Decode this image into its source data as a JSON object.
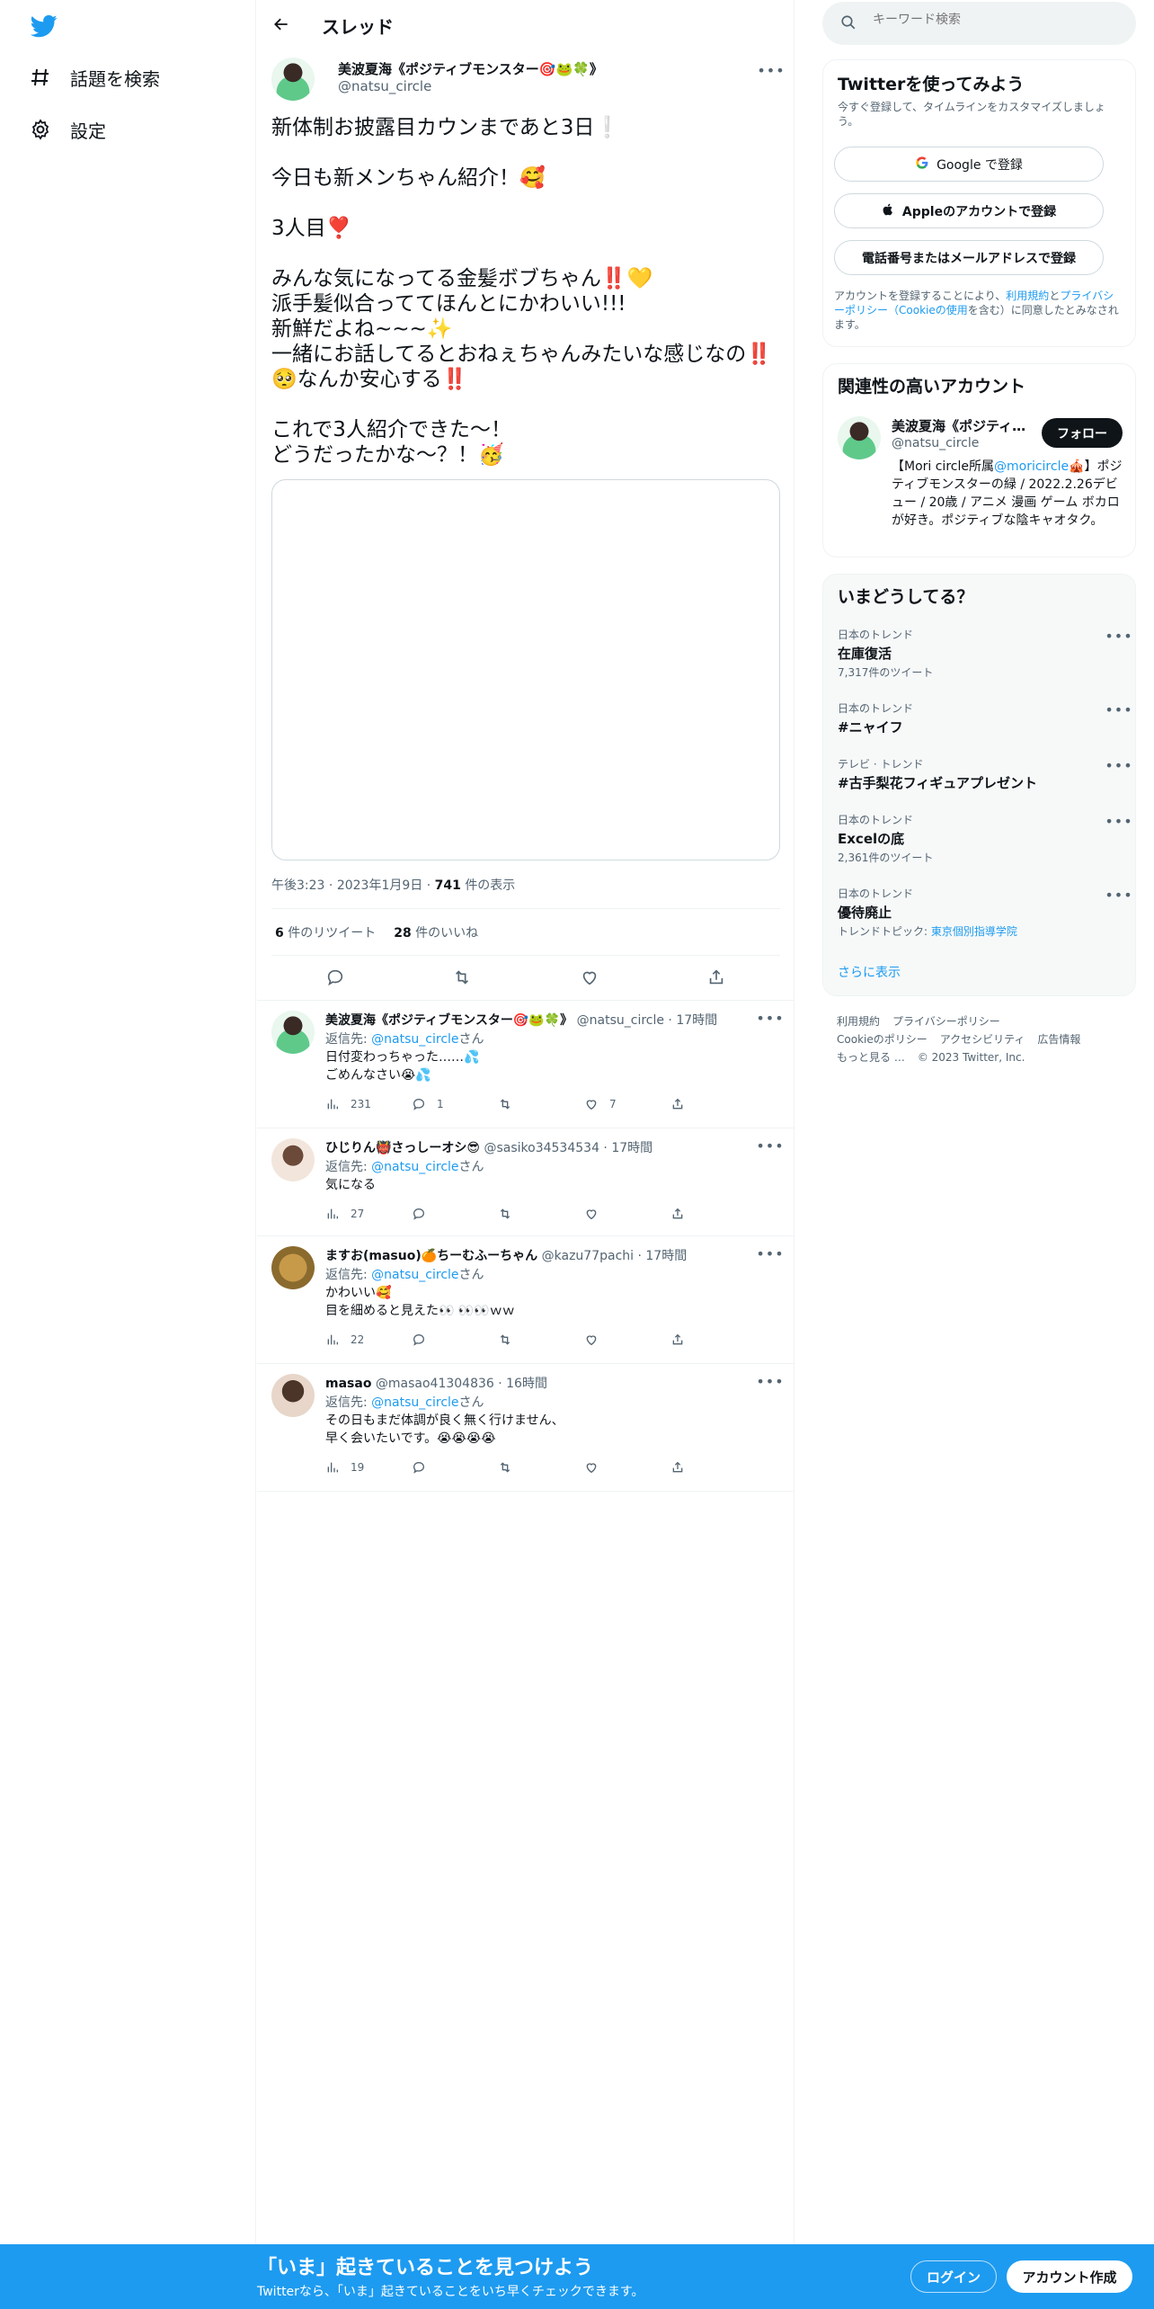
{
  "nav": {
    "items": [
      {
        "label": "話題を検索",
        "icon": "hashtag-icon"
      },
      {
        "label": "設定",
        "icon": "gear-icon"
      }
    ]
  },
  "header": {
    "title": "スレッド"
  },
  "tweet": {
    "author_name": "美波夏海《ポジティブモンスター🎯🐸🍀》",
    "author_handle": "@natsu_circle",
    "body": "新体制お披露目カウンまであと3日❕\n\n今日も新メンちゃん紹介！🥰\n\n3人目❣️\n\nみんな気になってる金髪ボブちゃん‼️💛\n派手髪似合っててほんとにかわいい!!!\n新鮮だよね~~~✨\n一緒にお話してるとおねぇちゃんみたいな感じなの‼️🥺なんか安心する‼️\n\nこれで3人紹介できた～！\nどうだったかな～？！🥳",
    "time": "午後3:23",
    "date": "2023年1月9日",
    "views": "741",
    "views_label": "件の表示",
    "retweets": "6",
    "retweets_label": "件のリツイート",
    "likes": "28",
    "likes_label": "件のいいね"
  },
  "replies": [
    {
      "name": "美波夏海《ポジティブモンスター🎯🐸🍀》",
      "handle": "@natsu_circle · 17時間",
      "reply_to_label": "返信先: ",
      "reply_to": "@natsu_circle",
      "reply_to_suffix": "さん",
      "text": "日付変わっちゃった……💦\nごめんなさい😭💦",
      "views": "231",
      "comments": "1",
      "retweets": "",
      "likes": "7"
    },
    {
      "name": "ひじりん👹さっしーオシ😎",
      "handle": "@sasiko34534534 · 17時間",
      "reply_to_label": "返信先: ",
      "reply_to": "@natsu_circle",
      "reply_to_suffix": "さん",
      "text": "気になる",
      "views": "27",
      "comments": "",
      "retweets": "",
      "likes": ""
    },
    {
      "name": "ますお(masuo)🍊ちーむふーちゃん",
      "handle": "@kazu77pachi · 17時間",
      "reply_to_label": "返信先: ",
      "reply_to": "@natsu_circle",
      "reply_to_suffix": "さん",
      "text": "かわいい🥰\n目を細めると見えた👀 👀👀ｗｗ",
      "views": "22",
      "comments": "",
      "retweets": "",
      "likes": ""
    },
    {
      "name": "masao",
      "handle": "@masao41304836 · 16時間",
      "reply_to_label": "返信先: ",
      "reply_to": "@natsu_circle",
      "reply_to_suffix": "さん",
      "text": "その日もまだ体調が良く無く行けません、\n早く会いたいです。😭😭😭😭",
      "views": "19",
      "comments": "",
      "retweets": "",
      "likes": ""
    }
  ],
  "search": {
    "placeholder": "キーワード検索"
  },
  "signup_card": {
    "title": "Twitterを使ってみよう",
    "subtitle": "今すぐ登録して、タイムラインをカスタマイズしましょう。",
    "google": "Google で登録",
    "apple": "Appleのアカウントで登録",
    "phone": "電話番号またはメールアドレスで登録",
    "terms_pre": "アカウントを登録することにより、",
    "terms_link1": "利用規約",
    "terms_mid1": "と",
    "terms_link2": "プライバシーポリシー（Cookieの使用",
    "terms_post": "を含む）に同意したとみなされます。"
  },
  "related": {
    "title": "関連性の高いアカウント",
    "name": "美波夏海《ポジティブモンスター🎯🐸🍀》",
    "handle": "@natsu_circle",
    "follow": "フォロー",
    "bio_pre": "【Mori circle所属",
    "bio_link": "@moricircle",
    "bio_post": "🎪】ポジティブモンスターの緑 / 2022.2.26デビュー / 20歳 / アニメ 漫画 ゲーム ボカロが好き。ポジティブな陰キャオタク。"
  },
  "trends": {
    "title": "いまどうしてる？",
    "items": [
      {
        "category": "日本のトレンド",
        "name": "在庫復活",
        "count": "7,317件のツイート"
      },
      {
        "category": "日本のトレンド",
        "name": "#ニャイフ",
        "count": ""
      },
      {
        "category": "テレビ · トレンド",
        "name": "#古手梨花フィギュアプレゼント",
        "count": ""
      },
      {
        "category": "日本のトレンド",
        "name": "Excelの底",
        "count": "2,361件のツイート"
      },
      {
        "category": "日本のトレンド",
        "name": "優待廃止",
        "count_pre": "トレンドトピック: ",
        "count_link": "東京個別指導学院"
      }
    ],
    "show_more": "さらに表示"
  },
  "footer": {
    "links": [
      "利用規約",
      "プライバシーポリシー",
      "Cookieのポリシー",
      "アクセシビリティ",
      "広告情報",
      "もっと見る …",
      "© 2023 Twitter, Inc."
    ]
  },
  "bottom_bar": {
    "title": "「いま」起きていることを見つけよう",
    "subtitle": "Twitterなら、「いま」起きていることをいち早くチェックできます。",
    "login": "ログイン",
    "signup": "アカウント作成"
  },
  "colors": {
    "accent": "#1d9bf0",
    "text": "#0f1419",
    "muted": "#536471",
    "border": "#eff3f4"
  }
}
